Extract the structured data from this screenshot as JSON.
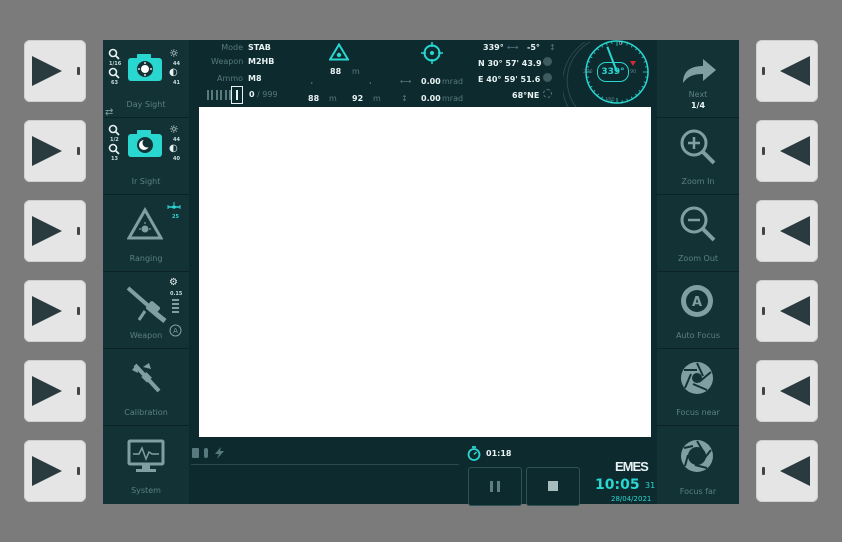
{
  "bezel": {
    "left_count": 6,
    "right_count": 6
  },
  "left_menu": {
    "day_sight": {
      "label": "Day Sight",
      "zoom_a": "1/16",
      "zoom_b": "63",
      "brightness": "44",
      "contrast": "41"
    },
    "ir_sight": {
      "label": "Ir Sight",
      "zoom_a": "1/2",
      "zoom_b": "13",
      "brightness": "44",
      "contrast": "40"
    },
    "ranging": {
      "label": "Ranging",
      "sub": "25"
    },
    "weapon": {
      "label": "Weapon",
      "sub": "0.15"
    },
    "calibration": {
      "label": "Calibration"
    },
    "system": {
      "label": "System"
    }
  },
  "right_menu": {
    "next": {
      "label": "Next",
      "page": "1/4"
    },
    "zoom_in": {
      "label": "Zoom In"
    },
    "zoom_out": {
      "label": "Zoom Out"
    },
    "auto_focus": {
      "label": "Auto Focus"
    },
    "focus_near": {
      "label": "Focus near"
    },
    "focus_far": {
      "label": "Focus far"
    }
  },
  "status": {
    "mode_label": "Mode",
    "mode_value": "STAB",
    "weapon_label": "Weapon",
    "weapon_value": "M2HB",
    "ammo_label": "Ammo",
    "ammo_value": "M8",
    "ammo_count": "0",
    "ammo_total": "/ 999"
  },
  "ranging": {
    "range_top": "88",
    "unit": "m",
    "range_a": "88",
    "range_b": "92"
  },
  "offsets": {
    "horizontal": "0.00",
    "vertical": "0.00",
    "unit": "mrad"
  },
  "position": {
    "azimuth": "339°",
    "elevation": "-5°",
    "lat": "N 30° 57' 43.9",
    "lon": "E 40° 59' 51.6",
    "bearing": "68°NE"
  },
  "compass": {
    "value": "339°",
    "heading_deg": 339,
    "ticks": [
      "0",
      "90",
      "180",
      "270"
    ]
  },
  "bottom": {
    "timer": "01:18",
    "time": "10:05",
    "seconds": "31",
    "date": "28/04/2021",
    "logo": "EMES"
  },
  "colors": {
    "accent": "#2ad6d0",
    "panel": "#123236",
    "screen": "#0d2a2f",
    "video": "#ffffff"
  }
}
